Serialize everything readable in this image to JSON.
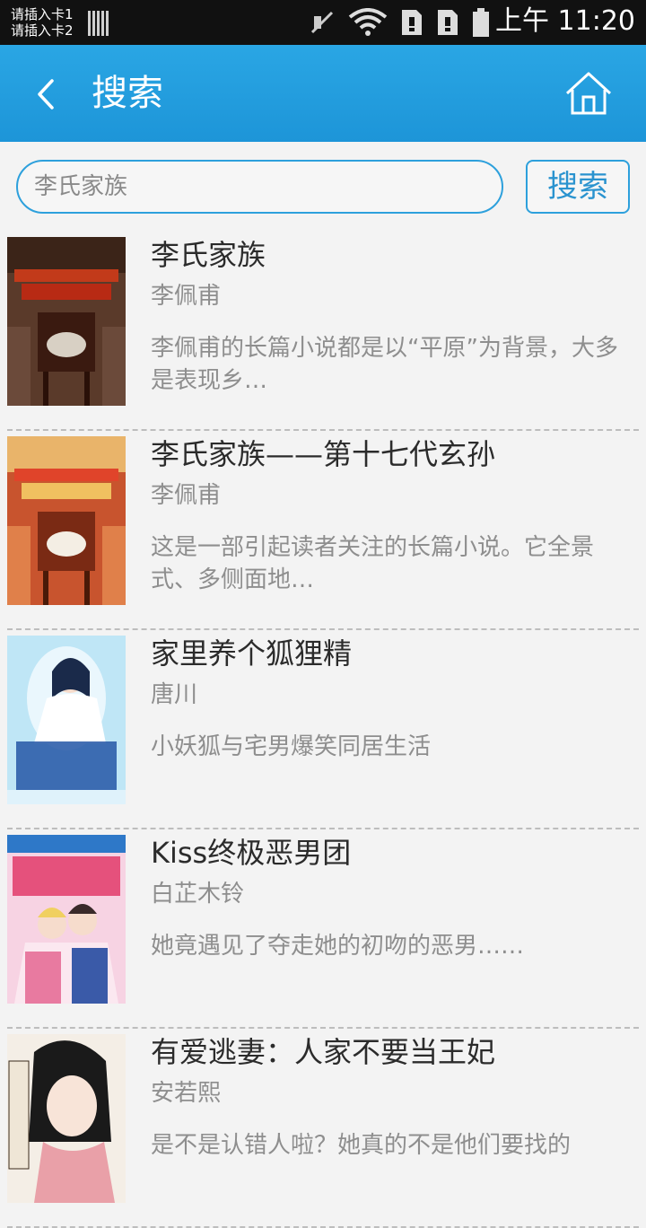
{
  "status_bar": {
    "sim1": "请插入卡1",
    "sim2": "请插入卡2",
    "time": "上午 11:20",
    "icons": [
      "signal-icon",
      "mute-icon",
      "wifi-icon",
      "sim-card-icon",
      "sim-card-icon",
      "battery-icon"
    ]
  },
  "header": {
    "title": "搜索",
    "back_icon": "chevron-left-icon",
    "home_icon": "home-icon",
    "background": "#1f98da"
  },
  "search": {
    "value": "李氏家族",
    "button_label": "搜索",
    "accent": "#2da0dc"
  },
  "results": [
    {
      "title": "李氏家族",
      "author": "李佩甫",
      "description": "李佩甫的长篇小说都是以“平原”为背景，大多是表现乡…"
    },
    {
      "title": "李氏家族——第十七代玄孙",
      "author": "李佩甫",
      "description": "这是一部引起读者关注的长篇小说。它全景式、多侧面地…"
    },
    {
      "title": "家里养个狐狸精",
      "author": "唐川",
      "description": "小妖狐与宅男爆笑同居生活"
    },
    {
      "title": "Kiss终极恶男团",
      "author": "白芷木铃",
      "description": "她竟遇见了夺走她的初吻的恶男……"
    },
    {
      "title": "有爱逃妻：人家不要当王妃",
      "author": "安若熙",
      "description": "是不是认错人啦？她真的不是他们要找的"
    }
  ]
}
